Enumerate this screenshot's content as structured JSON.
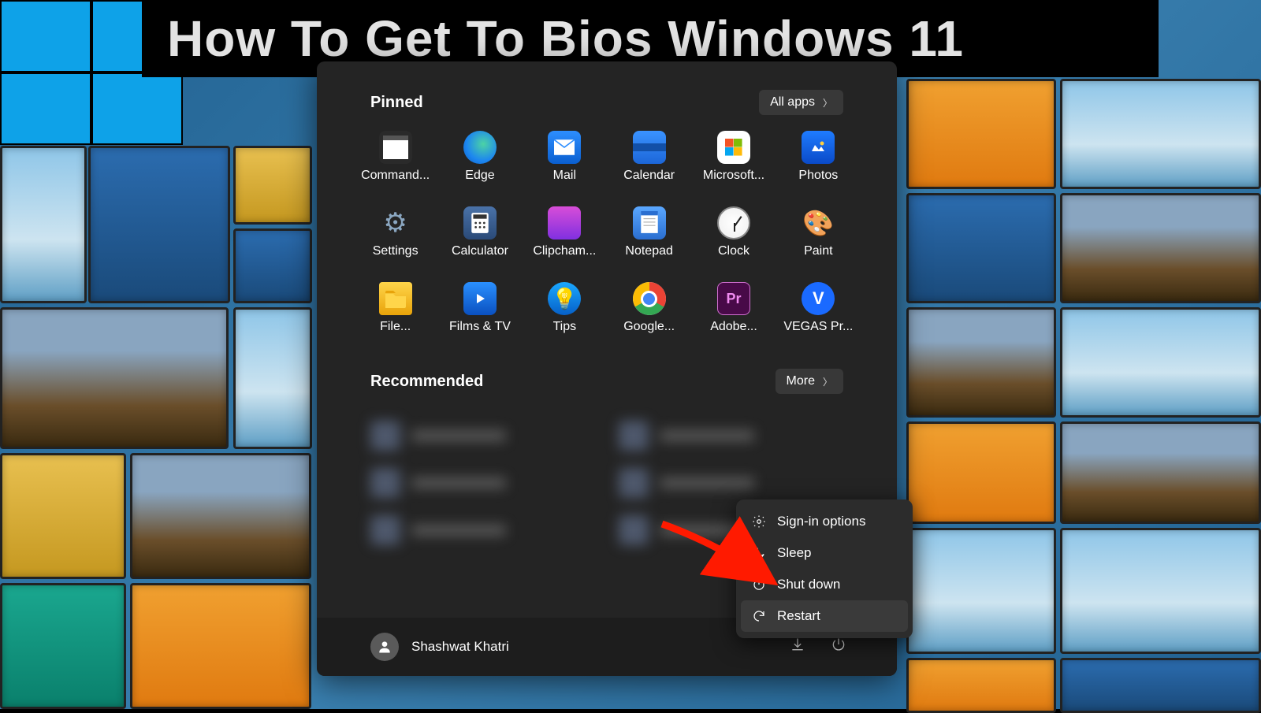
{
  "banner": {
    "title": "How To Get To Bios Windows 11"
  },
  "start_menu": {
    "pinned_label": "Pinned",
    "all_apps_label": "All apps",
    "pinned_apps": [
      {
        "label": "Command...",
        "icon": "cmd"
      },
      {
        "label": "Edge",
        "icon": "edge"
      },
      {
        "label": "Mail",
        "icon": "mail"
      },
      {
        "label": "Calendar",
        "icon": "calendar"
      },
      {
        "label": "Microsoft...",
        "icon": "store"
      },
      {
        "label": "Photos",
        "icon": "photos"
      },
      {
        "label": "Settings",
        "icon": "gear"
      },
      {
        "label": "Calculator",
        "icon": "calculator"
      },
      {
        "label": "Clipcham...",
        "icon": "clip"
      },
      {
        "label": "Notepad",
        "icon": "notepad"
      },
      {
        "label": "Clock",
        "icon": "clock"
      },
      {
        "label": "Paint",
        "icon": "paint"
      },
      {
        "label": "File...",
        "icon": "file"
      },
      {
        "label": "Films & TV",
        "icon": "films"
      },
      {
        "label": "Tips",
        "icon": "tips"
      },
      {
        "label": "Google...",
        "icon": "chrome"
      },
      {
        "label": "Adobe...",
        "icon": "pr"
      },
      {
        "label": "VEGAS Pr...",
        "icon": "vegas"
      }
    ],
    "recommended_label": "Recommended",
    "more_label": "More",
    "user_name": "Shashwat Khatri"
  },
  "power_menu": {
    "sign_in_options": "Sign-in options",
    "sleep": "Sleep",
    "shut_down": "Shut down",
    "restart": "Restart"
  }
}
